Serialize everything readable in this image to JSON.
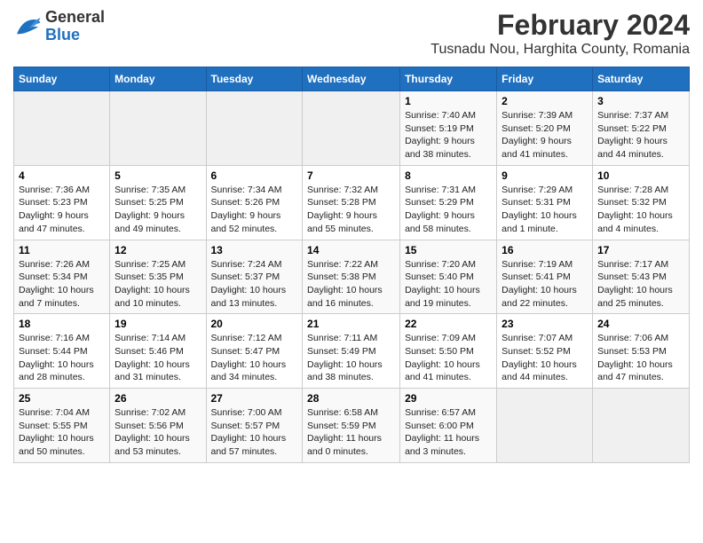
{
  "header": {
    "logo_line1": "General",
    "logo_line2": "Blue",
    "title": "February 2024",
    "subtitle": "Tusnadu Nou, Harghita County, Romania"
  },
  "days_of_week": [
    "Sunday",
    "Monday",
    "Tuesday",
    "Wednesday",
    "Thursday",
    "Friday",
    "Saturday"
  ],
  "weeks": [
    [
      {
        "day": "",
        "info": ""
      },
      {
        "day": "",
        "info": ""
      },
      {
        "day": "",
        "info": ""
      },
      {
        "day": "",
        "info": ""
      },
      {
        "day": "1",
        "info": "Sunrise: 7:40 AM\nSunset: 5:19 PM\nDaylight: 9 hours and 38 minutes."
      },
      {
        "day": "2",
        "info": "Sunrise: 7:39 AM\nSunset: 5:20 PM\nDaylight: 9 hours and 41 minutes."
      },
      {
        "day": "3",
        "info": "Sunrise: 7:37 AM\nSunset: 5:22 PM\nDaylight: 9 hours and 44 minutes."
      }
    ],
    [
      {
        "day": "4",
        "info": "Sunrise: 7:36 AM\nSunset: 5:23 PM\nDaylight: 9 hours and 47 minutes."
      },
      {
        "day": "5",
        "info": "Sunrise: 7:35 AM\nSunset: 5:25 PM\nDaylight: 9 hours and 49 minutes."
      },
      {
        "day": "6",
        "info": "Sunrise: 7:34 AM\nSunset: 5:26 PM\nDaylight: 9 hours and 52 minutes."
      },
      {
        "day": "7",
        "info": "Sunrise: 7:32 AM\nSunset: 5:28 PM\nDaylight: 9 hours and 55 minutes."
      },
      {
        "day": "8",
        "info": "Sunrise: 7:31 AM\nSunset: 5:29 PM\nDaylight: 9 hours and 58 minutes."
      },
      {
        "day": "9",
        "info": "Sunrise: 7:29 AM\nSunset: 5:31 PM\nDaylight: 10 hours and 1 minute."
      },
      {
        "day": "10",
        "info": "Sunrise: 7:28 AM\nSunset: 5:32 PM\nDaylight: 10 hours and 4 minutes."
      }
    ],
    [
      {
        "day": "11",
        "info": "Sunrise: 7:26 AM\nSunset: 5:34 PM\nDaylight: 10 hours and 7 minutes."
      },
      {
        "day": "12",
        "info": "Sunrise: 7:25 AM\nSunset: 5:35 PM\nDaylight: 10 hours and 10 minutes."
      },
      {
        "day": "13",
        "info": "Sunrise: 7:24 AM\nSunset: 5:37 PM\nDaylight: 10 hours and 13 minutes."
      },
      {
        "day": "14",
        "info": "Sunrise: 7:22 AM\nSunset: 5:38 PM\nDaylight: 10 hours and 16 minutes."
      },
      {
        "day": "15",
        "info": "Sunrise: 7:20 AM\nSunset: 5:40 PM\nDaylight: 10 hours and 19 minutes."
      },
      {
        "day": "16",
        "info": "Sunrise: 7:19 AM\nSunset: 5:41 PM\nDaylight: 10 hours and 22 minutes."
      },
      {
        "day": "17",
        "info": "Sunrise: 7:17 AM\nSunset: 5:43 PM\nDaylight: 10 hours and 25 minutes."
      }
    ],
    [
      {
        "day": "18",
        "info": "Sunrise: 7:16 AM\nSunset: 5:44 PM\nDaylight: 10 hours and 28 minutes."
      },
      {
        "day": "19",
        "info": "Sunrise: 7:14 AM\nSunset: 5:46 PM\nDaylight: 10 hours and 31 minutes."
      },
      {
        "day": "20",
        "info": "Sunrise: 7:12 AM\nSunset: 5:47 PM\nDaylight: 10 hours and 34 minutes."
      },
      {
        "day": "21",
        "info": "Sunrise: 7:11 AM\nSunset: 5:49 PM\nDaylight: 10 hours and 38 minutes."
      },
      {
        "day": "22",
        "info": "Sunrise: 7:09 AM\nSunset: 5:50 PM\nDaylight: 10 hours and 41 minutes."
      },
      {
        "day": "23",
        "info": "Sunrise: 7:07 AM\nSunset: 5:52 PM\nDaylight: 10 hours and 44 minutes."
      },
      {
        "day": "24",
        "info": "Sunrise: 7:06 AM\nSunset: 5:53 PM\nDaylight: 10 hours and 47 minutes."
      }
    ],
    [
      {
        "day": "25",
        "info": "Sunrise: 7:04 AM\nSunset: 5:55 PM\nDaylight: 10 hours and 50 minutes."
      },
      {
        "day": "26",
        "info": "Sunrise: 7:02 AM\nSunset: 5:56 PM\nDaylight: 10 hours and 53 minutes."
      },
      {
        "day": "27",
        "info": "Sunrise: 7:00 AM\nSunset: 5:57 PM\nDaylight: 10 hours and 57 minutes."
      },
      {
        "day": "28",
        "info": "Sunrise: 6:58 AM\nSunset: 5:59 PM\nDaylight: 11 hours and 0 minutes."
      },
      {
        "day": "29",
        "info": "Sunrise: 6:57 AM\nSunset: 6:00 PM\nDaylight: 11 hours and 3 minutes."
      },
      {
        "day": "",
        "info": ""
      },
      {
        "day": "",
        "info": ""
      }
    ]
  ]
}
